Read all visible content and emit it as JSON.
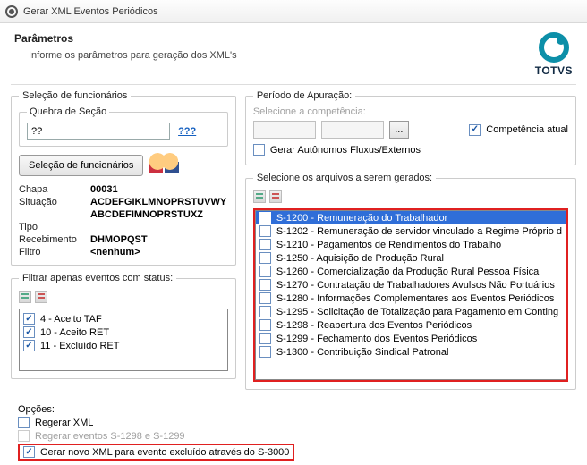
{
  "window": {
    "title": "Gerar XML Eventos Periódicos"
  },
  "header": {
    "title": "Parâmetros",
    "description": "Informe os parâmetros para geração dos XML's",
    "brand": "TOTVS"
  },
  "selection": {
    "legend": "Seleção de funcionários",
    "quebra_legend": "Quebra de Seção",
    "quebra_value": "??",
    "quebra_help": "???",
    "button": "Seleção de funcionários",
    "fields": {
      "chapa_k": "Chapa",
      "chapa_v": "00031",
      "situacao_k": "Situação",
      "situacao_v": "ACDEFGIKLMNOPRSTUVWY",
      "_blank_k": "",
      "blank_v": "ABCDEFIMNOPRSTUXZ",
      "tipo_k": "Tipo",
      "receb_k": "Recebimento",
      "receb_v": "DHMOPQST",
      "filtro_k": "Filtro",
      "filtro_v": "<nenhum>"
    }
  },
  "statusfilter": {
    "legend": "Filtrar apenas eventos com status:",
    "items": [
      "4 - Aceito TAF",
      "10 - Aceito RET",
      "11 - Excluído RET"
    ]
  },
  "period": {
    "legend": "Período de Apuração:",
    "competencia_label": "Selecione a competência:",
    "competencia_atual": "Competência atual",
    "autonomos": "Gerar Autônomos Fluxus/Externos"
  },
  "files": {
    "legend": "Selecione os arquivos a serem gerados:",
    "items": [
      {
        "checked": true,
        "label": "S-1200 - Remuneração do Trabalhador",
        "selected": true
      },
      {
        "checked": false,
        "label": "S-1202 - Remuneração de servidor vinculado a Regime Próprio d"
      },
      {
        "checked": false,
        "label": "S-1210 - Pagamentos de Rendimentos do Trabalho"
      },
      {
        "checked": false,
        "label": "S-1250 - Aquisição de Produção Rural"
      },
      {
        "checked": false,
        "label": "S-1260 - Comercialização da Produção Rural Pessoa Física"
      },
      {
        "checked": false,
        "label": "S-1270 - Contratação de Trabalhadores Avulsos Não Portuários"
      },
      {
        "checked": false,
        "label": "S-1280 - Informações Complementares aos Eventos Periódicos"
      },
      {
        "checked": false,
        "label": "S-1295 - Solicitação de Totalização para Pagamento em Conting"
      },
      {
        "checked": false,
        "label": "S-1298 - Reabertura dos Eventos Periódicos"
      },
      {
        "checked": false,
        "label": "S-1299 - Fechamento dos Eventos Periódicos"
      },
      {
        "checked": false,
        "label": "S-1300 - Contribuição Sindical Patronal"
      }
    ]
  },
  "options": {
    "legend": "Opções:",
    "regerar_xml": "Regerar XML",
    "regerar_s1298": "Regerar eventos S-1298 e S-1299",
    "gerar_excluido": "Gerar novo XML para evento excluído através do S-3000"
  }
}
